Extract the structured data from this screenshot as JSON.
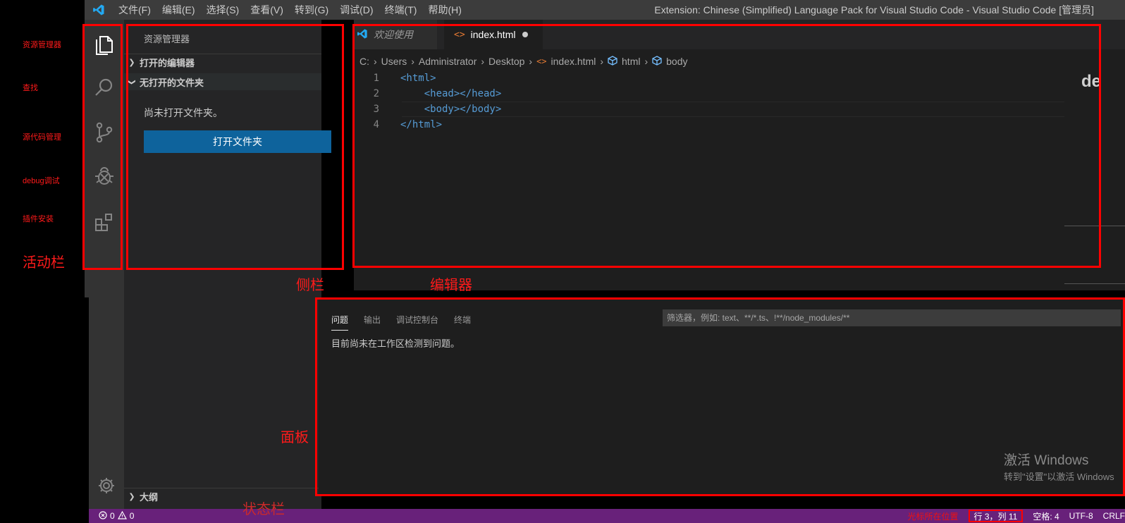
{
  "titlebar": {
    "menu": [
      "文件(F)",
      "编辑(E)",
      "选择(S)",
      "查看(V)",
      "转到(G)",
      "调试(D)",
      "终端(T)",
      "帮助(H)"
    ],
    "window_title": "Extension: Chinese (Simplified) Language Pack for Visual Studio Code - Visual Studio Code [管理员]"
  },
  "activitybar": {
    "icons": [
      "files-icon",
      "search-icon",
      "source-control-icon",
      "debug-icon",
      "extensions-icon"
    ],
    "bottom_icon": "gear-icon"
  },
  "sidebar": {
    "title": "资源管理器",
    "section_open_editors": "打开的编辑器",
    "section_no_folder": "无打开的文件夹",
    "no_folder_message": "尚未打开文件夹。",
    "open_folder_button": "打开文件夹",
    "section_outline": "大纲"
  },
  "editor": {
    "tabs": [
      {
        "label": "欢迎使用",
        "icon": "vscode-icon"
      },
      {
        "label": "index.html",
        "icon": "html-icon",
        "dirty": true
      }
    ],
    "breadcrumb": [
      "C:",
      "Users",
      "Administrator",
      "Desktop",
      "index.html",
      "html",
      "body"
    ],
    "code_lines": [
      {
        "num": "1",
        "indent": "",
        "content": "<html>"
      },
      {
        "num": "2",
        "indent": "    ",
        "content": "<head></head>"
      },
      {
        "num": "3",
        "indent": "    ",
        "content": "<body></body>"
      },
      {
        "num": "4",
        "indent": "",
        "content": "</html>"
      }
    ],
    "minimap_text": "de"
  },
  "panel": {
    "tabs": [
      "问题",
      "输出",
      "调试控制台",
      "终端"
    ],
    "filter_placeholder": "筛选器，例如: text、**/*.ts、!**/node_modules/**",
    "message": "目前尚未在工作区检测到问题。"
  },
  "statusbar": {
    "errors": "0",
    "warnings": "0",
    "jump_label": "光标所在位置",
    "cursor_position": "行 3，列 11",
    "indent": "空格: 4",
    "encoding": "UTF-8",
    "eol": "CRLF"
  },
  "watermark": {
    "line1": "激活 Windows",
    "line2": "转到\"设置\"以激活 Windows"
  },
  "annotations": {
    "explorer": "资源管理器",
    "search": "查找",
    "scm": "源代码管理",
    "debug": "debug调试",
    "extensions": "插件安装",
    "activitybar": "活动栏",
    "sidebar": "侧栏",
    "editor": "编辑器",
    "panel": "面板",
    "statusbar": "状态栏"
  },
  "colors": {
    "annotation_red": "#ff0000",
    "statusbar": "#68217a",
    "button": "#0e639c"
  }
}
